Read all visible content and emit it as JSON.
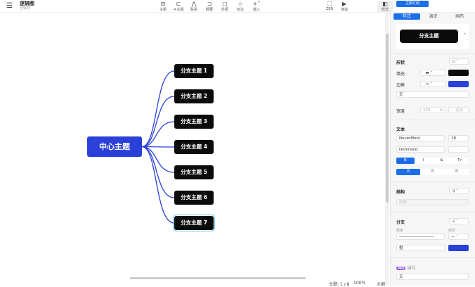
{
  "header": {
    "title": "逻辑图",
    "status": "已保存",
    "subscribe": "立即订阅",
    "tools": [
      {
        "label": "主题",
        "icon": "topic-icon"
      },
      {
        "label": "子主题",
        "icon": "subtopic-icon"
      },
      {
        "label": "联系",
        "icon": "relationship-icon"
      },
      {
        "label": "概要",
        "icon": "summary-icon"
      },
      {
        "label": "外框",
        "icon": "boundary-icon"
      },
      {
        "label": "标注",
        "icon": "callout-icon"
      },
      {
        "label": "插入",
        "icon": "plus-icon"
      },
      {
        "label": "ZEN",
        "icon": "zen-icon"
      },
      {
        "label": "演说",
        "icon": "present-icon"
      },
      {
        "label": "样式",
        "icon": "style-icon"
      }
    ]
  },
  "map": {
    "center": "中心主题",
    "branches": [
      "分支主题 1",
      "分支主题 2",
      "分支主题 3",
      "分支主题 4",
      "分支主题 5",
      "分支主题 6",
      "分支主题 7"
    ],
    "selected": 7,
    "center_color": "#2a40d8",
    "line_color": "#2a40d8"
  },
  "status": {
    "topics": "主题: 1 / 8",
    "zoom": "100%",
    "outline": "大纲"
  },
  "panel": {
    "tabs": [
      "样式",
      "演说",
      "画布"
    ],
    "preview": "分支主题",
    "shape": {
      "title": "形状",
      "fill": "填充",
      "border": "边框",
      "border_style": "无",
      "width_label": "宽度",
      "width_value": "125",
      "width_unit": "PX",
      "fit": "适合",
      "fill_color": "#0b0b0b",
      "border_color": "#2a40d8"
    },
    "text": {
      "title": "文本",
      "font": "NeverMind",
      "size": "18",
      "weight": "Demibold",
      "bold": "B",
      "italic": "I",
      "strike": "S",
      "case": "Tт"
    },
    "structure": {
      "title": "结构",
      "direction": "向右"
    },
    "branch": {
      "title": "分支",
      "line_label": "线条",
      "style_label": "线形",
      "thickness": "粗",
      "color": "#2a40d8"
    },
    "numbering": {
      "badge": "PRO",
      "title": "编号",
      "value": "无"
    }
  }
}
